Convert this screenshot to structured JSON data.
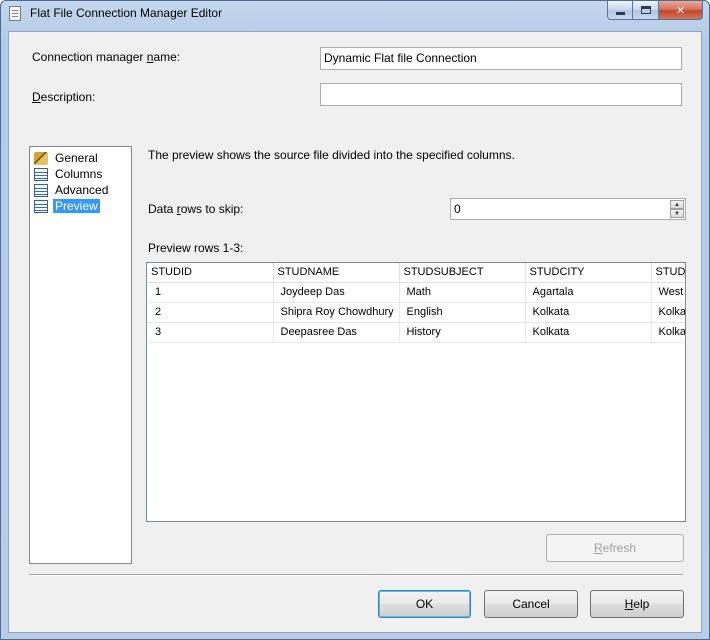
{
  "window": {
    "title": "Flat File Connection Manager Editor"
  },
  "form": {
    "connection_name_label_pre": "Connection manager ",
    "connection_name_label_hotkey": "n",
    "connection_name_label_post": "ame:",
    "connection_name_value": "Dynamic Flat file Connection",
    "description_label_pre": "",
    "description_label_hotkey": "D",
    "description_label_post": "escription:",
    "description_value": ""
  },
  "nav": {
    "items": [
      {
        "label": "General",
        "icon": "general-icon"
      },
      {
        "label": "Columns",
        "icon": "columns-icon"
      },
      {
        "label": "Advanced",
        "icon": "advanced-icon"
      },
      {
        "label": "Preview",
        "icon": "preview-icon",
        "selected": true
      }
    ]
  },
  "preview": {
    "info_text": "The preview shows the source file divided into the specified columns.",
    "skip_label_pre": "Data ",
    "skip_label_hotkey": "r",
    "skip_label_post": "ows to skip:",
    "skip_value": "0",
    "rows_label": "Preview rows 1-3:",
    "columns": [
      "STUDID",
      "STUDNAME",
      "STUDSUBJECT",
      "STUDCITY",
      "STUDSTATE"
    ],
    "rows": [
      [
        "1",
        "Joydeep Das",
        "Math",
        "Agartala",
        "West"
      ],
      [
        "2",
        "Shipra Roy Chowdhury",
        "English",
        "Kolkata",
        "Kolkata"
      ],
      [
        "3",
        "Deepasree Das",
        "History",
        "Kolkata",
        "Kolkata"
      ]
    ],
    "refresh_label_hotkey": "R",
    "refresh_label_post": "efresh"
  },
  "buttons": {
    "ok": "OK",
    "cancel": "Cancel",
    "help_hotkey": "H",
    "help_post": "elp"
  }
}
